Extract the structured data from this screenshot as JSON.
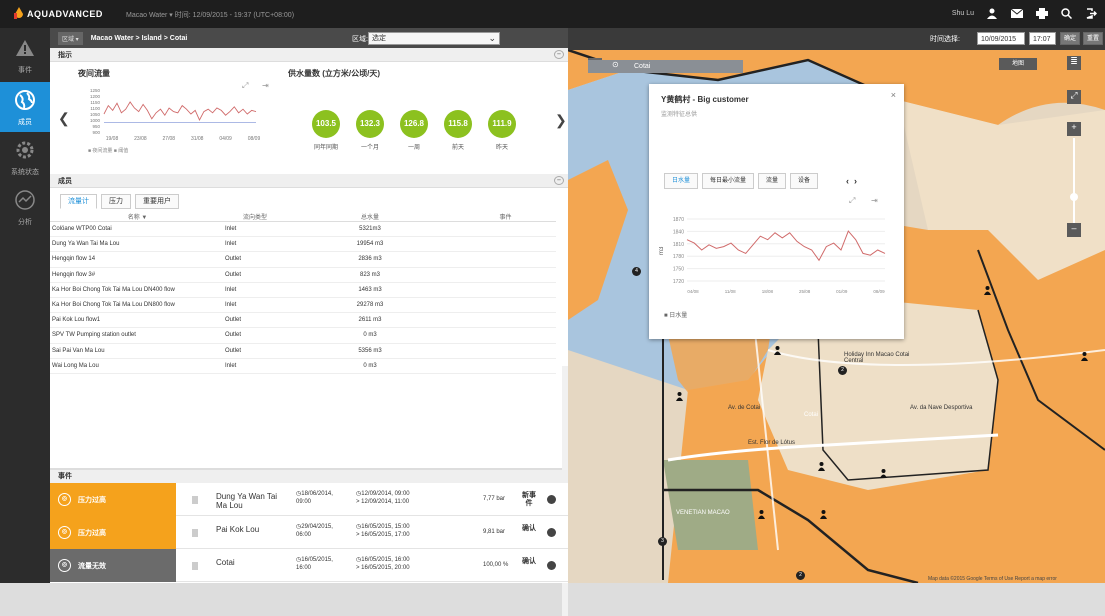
{
  "topbar": {
    "brand": "AQUADVANCED",
    "breadcrumb": "Macao Water  ▾   时间: 12/09/2015 - 19:37 (UTC+08:00)",
    "user": "Shu Lu"
  },
  "sidebar": {
    "items": [
      {
        "label": "事件"
      },
      {
        "label": "成员"
      },
      {
        "label": "系统状态"
      },
      {
        "label": "分析"
      }
    ]
  },
  "location_bar": {
    "tag": "区域 ▾",
    "path": "Macao Water > Island > Cotai",
    "area_label": "区域:",
    "area_value": "选定"
  },
  "indicators": {
    "header": "指示",
    "night_flow_title": "夜间流量",
    "supply_title": "供水量数 (立方米/公顷/天)",
    "chart_legend": "■ 夜间流量   ■ 阈值",
    "bubbles": [
      {
        "value": "103.5",
        "label": "同年同期"
      },
      {
        "value": "132.3",
        "label": "一个月"
      },
      {
        "value": "126.8",
        "label": "一周"
      },
      {
        "value": "115.8",
        "label": "前天"
      },
      {
        "value": "111.9",
        "label": "昨天"
      }
    ]
  },
  "members": {
    "header": "成员",
    "tabs": [
      "流量计",
      "压力",
      "重要用户"
    ],
    "columns": [
      "名称 ▼",
      "流向类型",
      "总水量",
      "事件"
    ],
    "rows": [
      {
        "name": "Colöane WTP00 Cotai",
        "type": "Inlet",
        "volume": "5321m3"
      },
      {
        "name": "Dung Ya Wan Tai Ma Lou",
        "type": "Inlet",
        "volume": "19954 m3"
      },
      {
        "name": "Hengqin flow 14",
        "type": "Outlet",
        "volume": "2836 m3"
      },
      {
        "name": "Hengqin flow 3#",
        "type": "Outlet",
        "volume": "823 m3"
      },
      {
        "name": "Ka Hor Boi Chong Tok Tai Ma Lou DN400 flow",
        "type": "Inlet",
        "volume": "1463 m3"
      },
      {
        "name": "Ka Hor Boi Chong Tok Tai Ma Lou DN800 flow",
        "type": "Inlet",
        "volume": "29278 m3"
      },
      {
        "name": "Pai Kok Lou flow1",
        "type": "Outlet",
        "volume": "2611 m3"
      },
      {
        "name": "SPV TW Pumping station outlet",
        "type": "Outlet",
        "volume": "0 m3"
      },
      {
        "name": "Sai Pai Van Ma Lou",
        "type": "Outlet",
        "volume": "5356 m3"
      },
      {
        "name": "Wai Long Ma Lou",
        "type": "Inlet",
        "volume": "0 m3"
      }
    ]
  },
  "events": {
    "header": "事件",
    "rows": [
      {
        "type": "压力过高",
        "color": "#f5a21c",
        "location": "Dung Ya Wan Tai Ma Lou",
        "start": "◷18/06/2014, 09:00",
        "end": "◷12/09/2014, 09:00\n> 12/09/2014, 11:00",
        "value": "7,77 bar",
        "action": "新事件"
      },
      {
        "type": "压力过高",
        "color": "#f5a21c",
        "location": "Pai Kok Lou",
        "start": "◷29/04/2015, 06:00",
        "end": "◷16/05/2015, 15:00\n> 16/05/2015, 17:00",
        "value": "9,81 bar",
        "action": "确认"
      },
      {
        "type": "流量无效",
        "color": "#6b6b6b",
        "location": "Cotai",
        "start": "◷16/05/2015, 16:00",
        "end": "◷16/05/2015, 16:00\n> 16/05/2015, 20:00",
        "value": "100,00 %",
        "action": "确认"
      }
    ]
  },
  "map": {
    "search": "Cotai",
    "time_label": "时间选择:",
    "date": "10/09/2015",
    "time": "17:07",
    "btn1": "确定",
    "btn2": "重置",
    "map_btn": "地图",
    "credit": "Map data ©2015 Google   Terms of Use   Report a map error",
    "labels": [
      "Cotai",
      "Av. de Cotai",
      "Est. Flor de Lótus",
      "Holiday Inn Macao Cotai Central",
      "VENETIAN MACAO",
      "Av. da Nave Desportiva"
    ],
    "popup": {
      "title": "Y黄鹤村 - Big customer",
      "subtitle": "监测特征总供",
      "tabs": [
        "日水量",
        "每日最小流量",
        "流量",
        "设备"
      ],
      "legend": "■ 日水量",
      "chart_ylabel": "m3"
    }
  },
  "chart_data": [
    {
      "type": "line",
      "title": "夜间流量",
      "xlabel": "",
      "ylabel": "",
      "x": [
        "19/08",
        "23/08",
        "27/08",
        "31/08",
        "04/09",
        "08/09"
      ],
      "yticks": [
        "1250",
        "1200",
        "1150",
        "1100",
        "1050",
        "1000",
        "950",
        "900"
      ],
      "series": [
        {
          "name": "夜间流量",
          "values": [
            1050,
            1120,
            1080,
            1140,
            1060,
            1090,
            1150,
            1100,
            1070,
            1130,
            1080,
            1010,
            1060,
            1090,
            1040,
            1100,
            1070,
            1060,
            1120,
            1090,
            1050,
            1080,
            1000,
            1070,
            1090,
            1060,
            1100,
            1080,
            1040,
            1070,
            1110,
            1060,
            1090,
            1050,
            1080,
            1070
          ]
        },
        {
          "name": "阈值",
          "values": [
            980,
            980,
            980,
            980,
            980,
            980,
            980,
            980,
            980,
            980,
            980,
            980,
            980,
            980,
            980,
            980,
            980,
            980,
            980,
            980,
            980,
            980,
            980,
            980,
            980,
            980,
            980,
            980,
            980,
            980,
            980,
            980,
            980,
            980,
            980,
            980
          ]
        }
      ],
      "color_main": "#d06a6a",
      "color_threshold": "#7b8fd6",
      "legend": "bottom"
    },
    {
      "type": "line",
      "title": "",
      "xlabel": "",
      "ylabel": "m3",
      "x": [
        "04/08",
        "11/08",
        "18/08",
        "25/08",
        "01/09",
        "08/09"
      ],
      "yticks": [
        "1870",
        "1840",
        "1810",
        "1780",
        "1750",
        "1720"
      ],
      "series": [
        {
          "name": "日水量",
          "values": [
            1820,
            1810,
            1790,
            1805,
            1795,
            1800,
            1810,
            1790,
            1780,
            1805,
            1830,
            1820,
            1840,
            1825,
            1840,
            1815,
            1800,
            1790,
            1760,
            1800,
            1810,
            1790,
            1845,
            1820,
            1780,
            1775,
            1790,
            1780
          ]
        }
      ],
      "ylim": [
        1700,
        1880
      ],
      "legend": "bottom"
    }
  ]
}
